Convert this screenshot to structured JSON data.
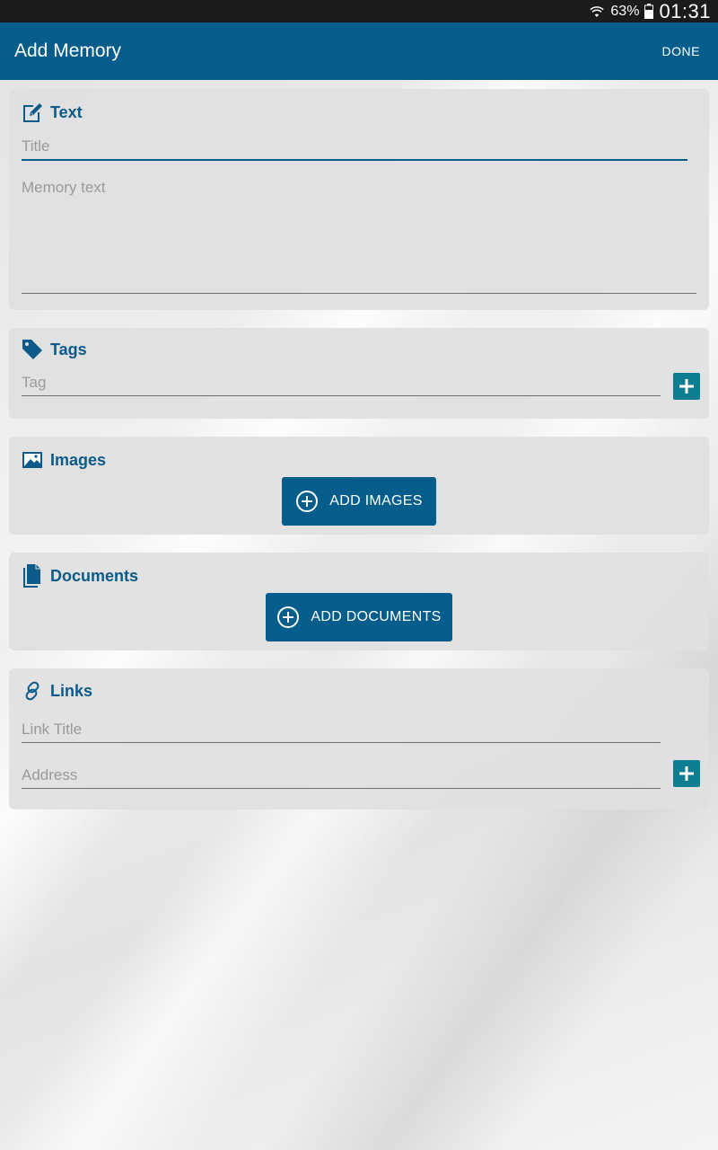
{
  "status_bar": {
    "battery_percent": "63%",
    "time": "01:31"
  },
  "app_bar": {
    "title": "Add Memory",
    "done_label": "DONE"
  },
  "sections": {
    "text": {
      "title": "Text",
      "icon": "edit-note-icon",
      "title_placeholder": "Title",
      "memory_placeholder": "Memory text"
    },
    "tags": {
      "title": "Tags",
      "icon": "tag-icon",
      "tag_placeholder": "Tag"
    },
    "images": {
      "title": "Images",
      "icon": "image-icon",
      "button_label": "ADD IMAGES"
    },
    "documents": {
      "title": "Documents",
      "icon": "document-icon",
      "button_label": "ADD DOCUMENTS"
    },
    "links": {
      "title": "Links",
      "icon": "link-icon",
      "link_title_placeholder": "Link Title",
      "address_placeholder": "Address"
    }
  },
  "colors": {
    "primary": "#045d8a",
    "accent": "#0d7d91",
    "status_bar": "#1b1b1b",
    "section_title": "#0b5a89"
  }
}
